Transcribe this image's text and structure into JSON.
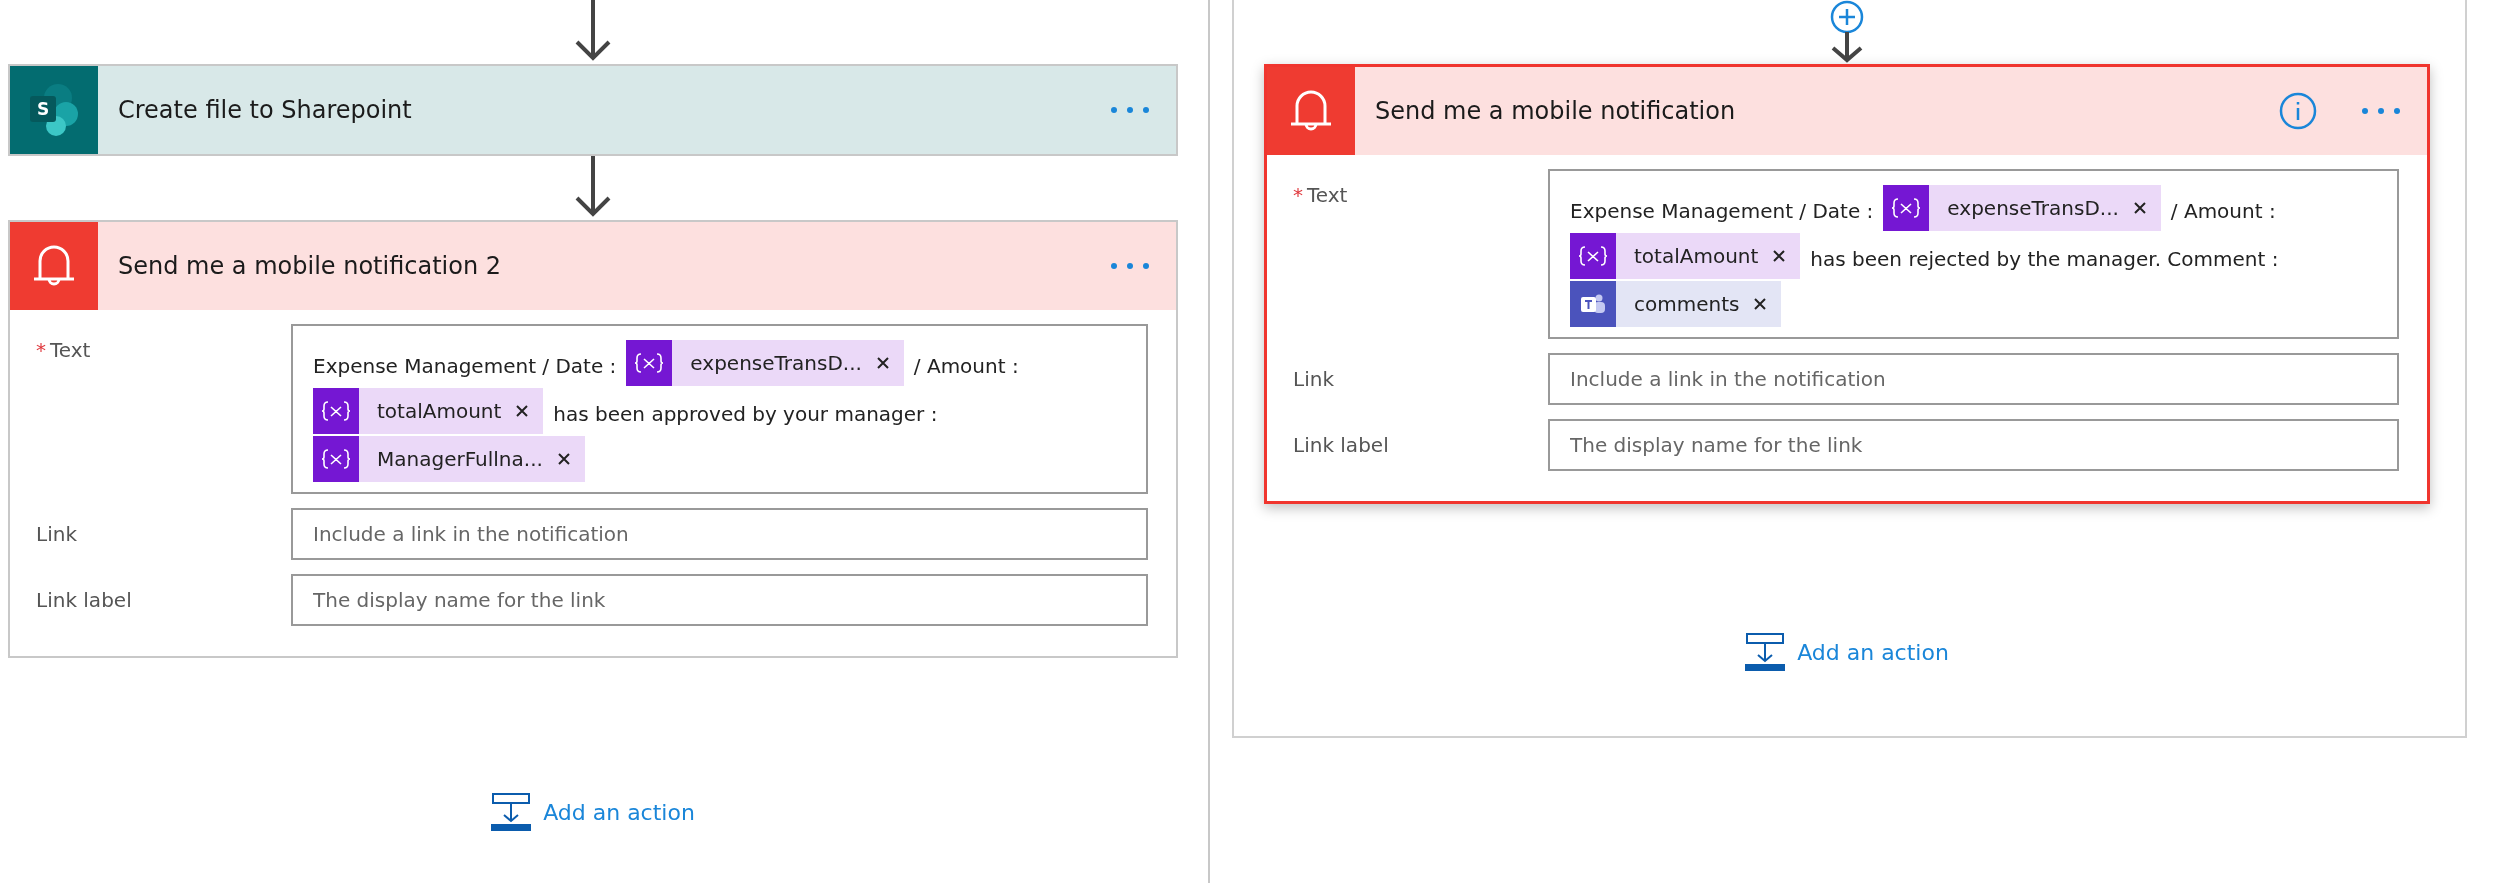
{
  "columns": [
    {
      "framed": false,
      "items": [
        {
          "kind": "arrow"
        },
        {
          "kind": "sharepoint_card",
          "logo_letter": "S",
          "title": "Create file to Sharepoint",
          "selected": false,
          "info_button": false
        },
        {
          "kind": "arrow"
        },
        {
          "kind": "notification_card",
          "title": "Send me a mobile notification 2",
          "selected": false,
          "info_button": false,
          "fields": [
            {
              "kind": "rich",
              "label": "Text",
              "required_mark": "*",
              "segments": [
                {
                  "kind": "text",
                  "text": "Expense Management / Date :"
                },
                {
                  "kind": "variable",
                  "text": "expenseTransD..."
                },
                {
                  "kind": "text",
                  "text": "/ Amount :"
                },
                {
                  "kind": "variable",
                  "text": "totalAmount"
                },
                {
                  "kind": "text",
                  "text": "has been approved by your manager :"
                },
                {
                  "kind": "variable",
                  "text": "ManagerFullna..."
                }
              ]
            },
            {
              "kind": "input",
              "label": "Link",
              "placeholder": "Include a link in the notification"
            },
            {
              "kind": "input",
              "label": "Link label",
              "placeholder": "The display name for the link"
            }
          ]
        }
      ],
      "add_action": "Add an action"
    },
    {
      "framed": true,
      "items": [
        {
          "kind": "plus_arrow"
        },
        {
          "kind": "notification_card",
          "title": "Send me a mobile notification",
          "selected": true,
          "info_button": true,
          "fields": [
            {
              "kind": "rich",
              "label": "Text",
              "required_mark": "*",
              "segments": [
                {
                  "kind": "text",
                  "text": "Expense Management / Date :"
                },
                {
                  "kind": "variable",
                  "text": "expenseTransD..."
                },
                {
                  "kind": "text",
                  "text": "/ Amount :"
                },
                {
                  "kind": "variable",
                  "text": "totalAmount"
                },
                {
                  "kind": "text",
                  "text": "has been rejected by the manager. Comment :"
                },
                {
                  "kind": "teams",
                  "text": "comments"
                }
              ]
            },
            {
              "kind": "input",
              "label": "Link",
              "placeholder": "Include a link in the notification"
            },
            {
              "kind": "input",
              "label": "Link label",
              "placeholder": "The display name for the link"
            }
          ]
        }
      ],
      "add_action": "Add an action"
    }
  ]
}
